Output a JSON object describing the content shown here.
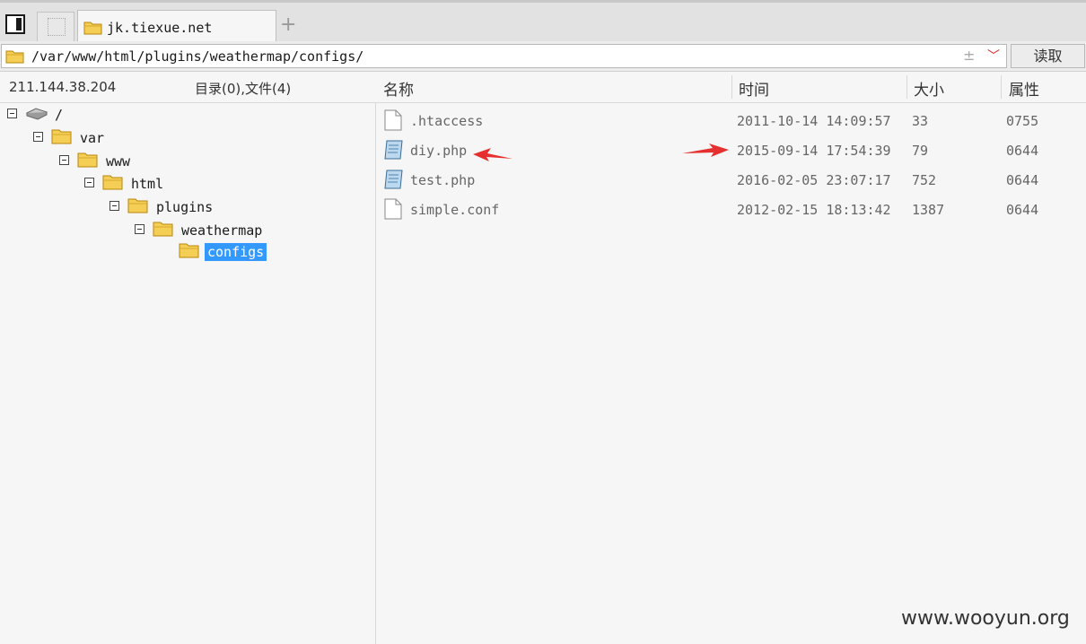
{
  "tab": {
    "title": "jk.tiexue.net",
    "add_icon": "+"
  },
  "address": {
    "path": "/var/www/html/plugins/weathermap/configs/",
    "pm_icon": "±",
    "dropdown_icon": "﹀",
    "read_button": "读取"
  },
  "status": {
    "ip": "211.144.38.204",
    "counts": "目录(0),文件(4)"
  },
  "columns": {
    "name": "名称",
    "time": "时间",
    "size": "大小",
    "attr": "属性"
  },
  "tree": [
    {
      "name": "/",
      "icon": "drive-icon",
      "expanded": true
    },
    {
      "name": "var",
      "icon": "folder-icon",
      "expanded": true
    },
    {
      "name": "www",
      "icon": "folder-icon",
      "expanded": true
    },
    {
      "name": "html",
      "icon": "folder-icon",
      "expanded": true
    },
    {
      "name": "plugins",
      "icon": "folder-icon",
      "expanded": true
    },
    {
      "name": "weathermap",
      "icon": "folder-icon",
      "expanded": true
    },
    {
      "name": "configs",
      "icon": "folder-icon",
      "selected": true
    }
  ],
  "files": [
    {
      "name": ".htaccess",
      "time": "2011-10-14 14:09:57",
      "size": "33",
      "attr": "0755",
      "icon": "file-icon"
    },
    {
      "name": "diy.php",
      "time": "2015-09-14 17:54:39",
      "size": "79",
      "attr": "0644",
      "icon": "php-file-icon"
    },
    {
      "name": "test.php",
      "time": "2016-02-05 23:07:17",
      "size": "752",
      "attr": "0644",
      "icon": "php-file-icon"
    },
    {
      "name": "simple.conf",
      "time": "2012-02-15 18:13:42",
      "size": "1387",
      "attr": "0644",
      "icon": "file-icon"
    }
  ],
  "annotation_color": "#e63030",
  "watermark": "www.wooyun.org"
}
